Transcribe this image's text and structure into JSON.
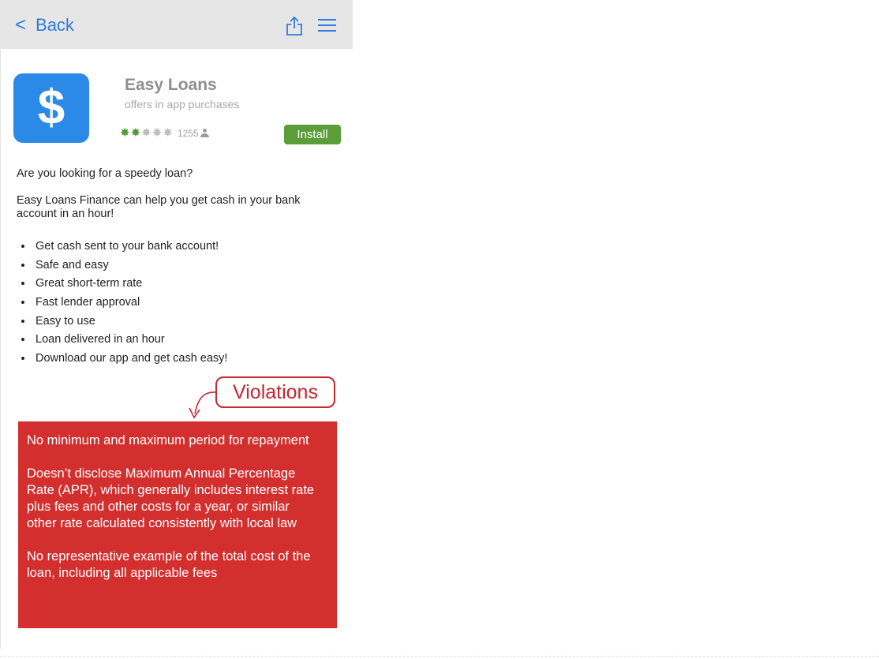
{
  "topbar": {
    "back_label": "Back",
    "back_icon": "chevron-left-icon",
    "share_icon": "share-icon",
    "menu_icon": "hamburger-menu-icon"
  },
  "app": {
    "icon_symbol": "$",
    "icon_color": "#2b89e8",
    "name": "Easy Loans",
    "subtitle": "offers in app purchases",
    "rating_filled": 2,
    "rating_max": 5,
    "rating_count": "1255",
    "install_label": "Install",
    "install_color": "#5a9d39"
  },
  "description": {
    "intro": "Are you looking for a speedy loan?",
    "body": "Easy Loans Finance can help you get cash in your bank account in an hour!",
    "bullets": [
      "Get cash sent to your bank account!",
      "Safe and easy",
      "Great short-term rate",
      "Fast lender approval",
      "Easy to use",
      "Loan delivered in an hour",
      "Download our app and get cash easy!"
    ]
  },
  "violations": {
    "label": "Violations",
    "color": "#d32f2f",
    "items": [
      "No minimum and maximum period for repayment",
      "Doesn’t disclose Maximum Annual Percentage Rate (APR), which generally includes interest rate plus fees and other costs for a year, or similar other rate calculated consistently with local law",
      "No representative example of the total cost of the loan, including all applicable fees"
    ]
  }
}
